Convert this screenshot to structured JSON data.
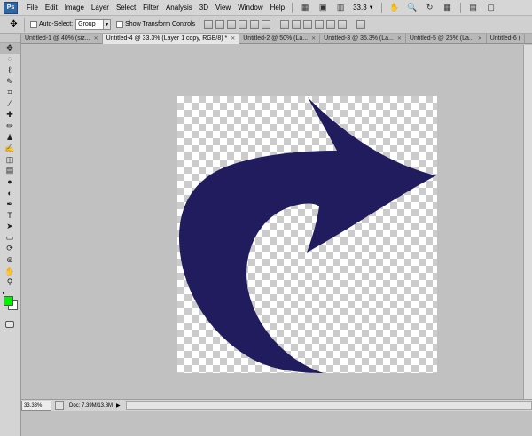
{
  "app": {
    "logo_text": "Ps"
  },
  "menu": {
    "items": [
      "File",
      "Edit",
      "Image",
      "Layer",
      "Select",
      "Filter",
      "Analysis",
      "3D",
      "View",
      "Window",
      "Help"
    ],
    "zoom_value": "33.3"
  },
  "options": {
    "auto_select_label": "Auto-Select:",
    "auto_select_value": "Group",
    "show_transform_label": "Show Transform Controls"
  },
  "tabs": [
    {
      "label": "Untitled-1 @ 40% (siz...",
      "active": false
    },
    {
      "label": "Untitled-4 @ 33.3% (Layer 1 copy, RGB/8) *",
      "active": true
    },
    {
      "label": "Untitled-2 @ 50% (La...",
      "active": false
    },
    {
      "label": "Untitled-3 @ 35.3% (La...",
      "active": false
    },
    {
      "label": "Untitled-5 @ 25% (La...",
      "active": false
    },
    {
      "label": "Untitled-6 (",
      "active": false
    }
  ],
  "status": {
    "zoom": "33.33%",
    "doc_info": "Doc: 7.39M/13.8M"
  },
  "colors": {
    "foreground": "#00f200",
    "background": "#ffffff",
    "shape_fill": "#201c5e"
  },
  "tools": [
    "move-icon",
    "marquee-icon",
    "lasso-icon",
    "quick-select-icon",
    "crop-icon",
    "eyedropper-icon",
    "healing-icon",
    "brush-icon",
    "clone-stamp-icon",
    "history-brush-icon",
    "eraser-icon",
    "gradient-icon",
    "blur-icon",
    "dodge-icon",
    "pen-icon",
    "type-icon",
    "path-select-icon",
    "shape-icon",
    "3d-rotate-icon",
    "3d-orbit-icon",
    "hand-icon",
    "zoom-icon"
  ]
}
